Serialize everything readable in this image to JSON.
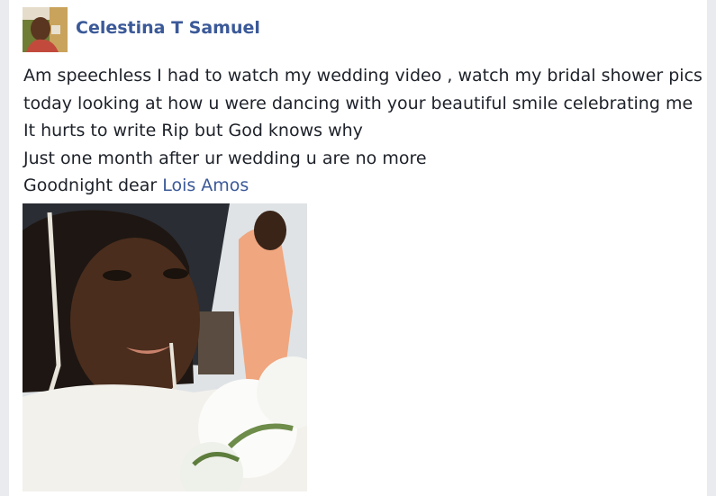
{
  "post": {
    "author": {
      "name": "Celestina T Samuel",
      "avatar_icon": "profile-avatar"
    },
    "text_lines": [
      "Am speechless I had to watch my wedding video , watch my bridal shower pics",
      "today looking at how u were dancing with your beautiful smile celebrating me",
      "It hurts to write Rip but God knows why",
      "Just one month after ur wedding u are no more"
    ],
    "last_line": {
      "prefix": "Goodnight dear ",
      "tag": "Lois Amos"
    },
    "photo": {
      "subject": "bride-portrait"
    }
  },
  "colors": {
    "link": "#3b5998",
    "text": "#1d2129",
    "card": "#ffffff",
    "page": "#e9ebee"
  }
}
